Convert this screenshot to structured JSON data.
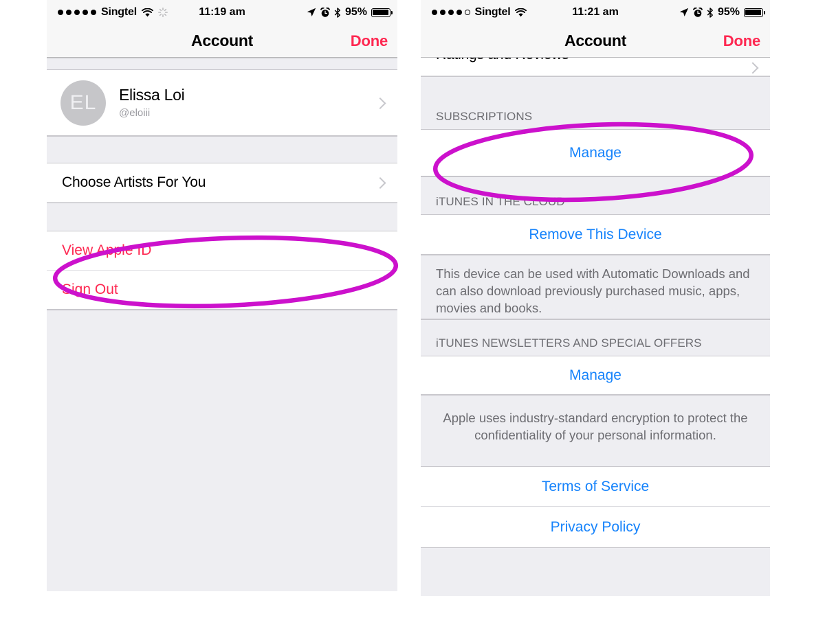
{
  "colors": {
    "accent_blue": "#1683fb",
    "accent_red": "#fe2851",
    "annotation_magenta": "#CC11CC",
    "group_bg": "#eeeef2",
    "separator": "#c8c7cc",
    "secondary_text": "#6d6d72"
  },
  "left_phone": {
    "status_bar": {
      "carrier": "Singtel",
      "signal_dots_filled": 5,
      "signal_dots_total": 5,
      "wifi_icon": "wifi-icon",
      "activity_icon": "activity-spinner-icon",
      "time": "11:19 am",
      "location_icon": "location-arrow-icon",
      "alarm_icon": "alarm-clock-icon",
      "bluetooth_icon": "bluetooth-icon",
      "battery_percent": "95%"
    },
    "nav": {
      "title": "Account",
      "done_label": "Done"
    },
    "account": {
      "initials": "EL",
      "name": "Elissa Loi",
      "handle": "@eloiii"
    },
    "rows": {
      "choose_artists": "Choose Artists For You",
      "view_apple_id": "View Apple ID",
      "sign_out": "Sign Out"
    },
    "annotation": {
      "target": "View Apple ID",
      "shape": "ellipse"
    }
  },
  "right_phone": {
    "status_bar": {
      "carrier": "Singtel",
      "signal_dots_filled": 4,
      "signal_dots_total": 5,
      "wifi_icon": "wifi-icon",
      "time": "11:21 am",
      "location_icon": "location-arrow-icon",
      "alarm_icon": "alarm-clock-icon",
      "bluetooth_icon": "bluetooth-icon",
      "battery_percent": "95%"
    },
    "nav": {
      "title": "Account",
      "done_label": "Done"
    },
    "rows": {
      "ratings_and_reviews": "Ratings and Reviews"
    },
    "sections": {
      "subscriptions": {
        "header": "SUBSCRIPTIONS",
        "action": "Manage"
      },
      "itunes_cloud": {
        "header": "iTUNES IN THE CLOUD",
        "action": "Remove This Device",
        "footnote": "This device can be used with Automatic Downloads and can also download previously purchased music, apps, movies and books."
      },
      "newsletters": {
        "header": "iTUNES NEWSLETTERS AND SPECIAL OFFERS",
        "action": "Manage",
        "footnote": "Apple uses industry-standard encryption to protect the confidentiality of your personal information."
      },
      "legal": {
        "terms": "Terms of Service",
        "privacy": "Privacy Policy"
      }
    },
    "annotation": {
      "target": "Manage",
      "shape": "ellipse"
    }
  }
}
